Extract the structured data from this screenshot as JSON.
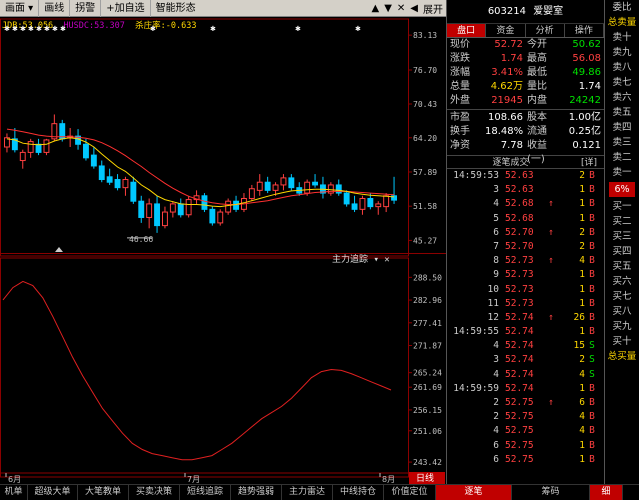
{
  "toolbar": {
    "items": [
      "画面",
      "画线",
      "拐警",
      "+加自选",
      "智能形态"
    ],
    "collapse_label": "展开",
    "up_arrow": "▲",
    "down_arrow": "▼",
    "close": "✕"
  },
  "kline": {
    "indicators": [
      {
        "text": "JDB:53.056",
        "color": "#ffd800"
      },
      {
        "text": "HUSDC:53.307",
        "color": "#c000c0"
      },
      {
        "text": "杀庄率:-0.633",
        "color": "#ffd800"
      }
    ],
    "y_labels": [
      "83.13",
      "76.70",
      "70.43",
      "64.20",
      "57.89",
      "51.58",
      "45.27"
    ],
    "low_label": "46.66",
    "candles": [
      {
        "o": 62.5,
        "h": 65.0,
        "l": 61.5,
        "c": 64.2
      },
      {
        "o": 64.0,
        "h": 66.0,
        "l": 61.5,
        "c": 62.0
      },
      {
        "o": 60.0,
        "h": 62.0,
        "l": 58.5,
        "c": 61.5
      },
      {
        "o": 61.5,
        "h": 64.0,
        "l": 60.5,
        "c": 63.5
      },
      {
        "o": 63.0,
        "h": 64.0,
        "l": 61.0,
        "c": 61.5
      },
      {
        "o": 61.5,
        "h": 64.0,
        "l": 61.0,
        "c": 63.8
      },
      {
        "o": 64.0,
        "h": 68.5,
        "l": 63.5,
        "c": 66.8
      },
      {
        "o": 66.8,
        "h": 67.5,
        "l": 63.5,
        "c": 64.0
      },
      {
        "o": 64.2,
        "h": 66.0,
        "l": 62.5,
        "c": 64.5
      },
      {
        "o": 64.5,
        "h": 65.8,
        "l": 62.0,
        "c": 63.0
      },
      {
        "o": 63.0,
        "h": 64.0,
        "l": 60.0,
        "c": 60.5
      },
      {
        "o": 61.0,
        "h": 62.5,
        "l": 58.5,
        "c": 59.0
      },
      {
        "o": 59.0,
        "h": 60.0,
        "l": 56.0,
        "c": 56.5
      },
      {
        "o": 57.0,
        "h": 58.5,
        "l": 55.5,
        "c": 56.0
      },
      {
        "o": 56.5,
        "h": 57.5,
        "l": 54.5,
        "c": 55.0
      },
      {
        "o": 55.0,
        "h": 57.0,
        "l": 53.5,
        "c": 56.5
      },
      {
        "o": 56.0,
        "h": 57.0,
        "l": 52.0,
        "c": 52.5
      },
      {
        "o": 52.5,
        "h": 53.5,
        "l": 48.5,
        "c": 49.5
      },
      {
        "o": 49.5,
        "h": 53.0,
        "l": 47.5,
        "c": 52.0
      },
      {
        "o": 52.0,
        "h": 53.5,
        "l": 46.66,
        "c": 48.0
      },
      {
        "o": 48.0,
        "h": 51.5,
        "l": 47.5,
        "c": 50.5
      },
      {
        "o": 50.5,
        "h": 52.5,
        "l": 49.5,
        "c": 52.0
      },
      {
        "o": 52.0,
        "h": 53.0,
        "l": 49.5,
        "c": 50.0
      },
      {
        "o": 50.0,
        "h": 53.5,
        "l": 49.5,
        "c": 52.8
      },
      {
        "o": 52.8,
        "h": 54.5,
        "l": 52.0,
        "c": 53.5
      },
      {
        "o": 53.5,
        "h": 54.0,
        "l": 50.5,
        "c": 51.0
      },
      {
        "o": 51.0,
        "h": 51.5,
        "l": 48.0,
        "c": 48.5
      },
      {
        "o": 48.5,
        "h": 51.0,
        "l": 48.0,
        "c": 50.5
      },
      {
        "o": 50.5,
        "h": 53.0,
        "l": 50.0,
        "c": 52.5
      },
      {
        "o": 52.5,
        "h": 53.5,
        "l": 50.5,
        "c": 51.0
      },
      {
        "o": 51.0,
        "h": 54.0,
        "l": 50.5,
        "c": 53.0
      },
      {
        "o": 53.0,
        "h": 55.5,
        "l": 52.5,
        "c": 54.8
      },
      {
        "o": 54.5,
        "h": 57.5,
        "l": 53.5,
        "c": 56.0
      },
      {
        "o": 56.0,
        "h": 57.0,
        "l": 54.0,
        "c": 54.5
      },
      {
        "o": 54.5,
        "h": 56.0,
        "l": 53.5,
        "c": 55.5
      },
      {
        "o": 55.5,
        "h": 57.5,
        "l": 54.5,
        "c": 56.8
      },
      {
        "o": 56.8,
        "h": 57.5,
        "l": 54.5,
        "c": 55.0
      },
      {
        "o": 55.0,
        "h": 56.0,
        "l": 53.5,
        "c": 54.0
      },
      {
        "o": 54.0,
        "h": 56.5,
        "l": 53.5,
        "c": 56.0
      },
      {
        "o": 56.0,
        "h": 57.5,
        "l": 55.0,
        "c": 55.5
      },
      {
        "o": 55.5,
        "h": 57.0,
        "l": 53.0,
        "c": 54.0
      },
      {
        "o": 54.0,
        "h": 56.0,
        "l": 53.5,
        "c": 55.5
      },
      {
        "o": 55.5,
        "h": 56.5,
        "l": 53.5,
        "c": 54.0
      },
      {
        "o": 54.0,
        "h": 54.5,
        "l": 51.5,
        "c": 52.0
      },
      {
        "o": 52.0,
        "h": 53.5,
        "l": 50.5,
        "c": 51.0
      },
      {
        "o": 51.0,
        "h": 53.5,
        "l": 50.0,
        "c": 53.0
      },
      {
        "o": 53.0,
        "h": 54.0,
        "l": 51.0,
        "c": 51.5
      },
      {
        "o": 51.5,
        "h": 52.5,
        "l": 50.0,
        "c": 52.0
      },
      {
        "o": 51.5,
        "h": 54.0,
        "l": 50.5,
        "c": 53.5
      },
      {
        "o": 53.5,
        "h": 57.0,
        "l": 52.0,
        "c": 52.7
      }
    ],
    "ma_fast": [
      64.0,
      63.8,
      63.2,
      63.0,
      62.9,
      63.0,
      63.6,
      64.0,
      64.2,
      64.0,
      63.4,
      62.5,
      61.2,
      60.0,
      58.8,
      58.0,
      56.8,
      55.5,
      54.6,
      53.5,
      52.8,
      52.4,
      52.0,
      51.9,
      51.9,
      51.8,
      51.6,
      51.5,
      51.7,
      51.9,
      52.2,
      52.6,
      53.0,
      53.4,
      53.8,
      54.1,
      54.4,
      54.5,
      54.6,
      54.7,
      54.7,
      54.6,
      54.5,
      54.3,
      54.0,
      53.8,
      53.6,
      53.5,
      53.4,
      53.3
    ],
    "ma_slow": [
      65.8,
      65.6,
      65.3,
      65.0,
      64.7,
      64.5,
      64.4,
      64.4,
      64.4,
      64.3,
      64.1,
      63.8,
      63.3,
      62.6,
      61.8,
      60.9,
      59.9,
      58.9,
      57.8,
      56.8,
      55.8,
      54.9,
      54.1,
      53.4,
      52.9,
      52.5,
      52.2,
      52.0,
      51.9,
      51.9,
      52.0,
      52.2,
      52.4,
      52.6,
      52.9,
      53.2,
      53.5,
      53.7,
      53.9,
      54.1,
      54.2,
      54.3,
      54.3,
      54.3,
      54.2,
      54.1,
      54.0,
      53.9,
      53.8,
      53.7
    ]
  },
  "indicator_panel": {
    "title": "主力追踪",
    "y_labels": [
      "288.50",
      "282.96",
      "277.41",
      "271.87",
      "265.24",
      "261.69",
      "256.15",
      "251.06",
      "243.42"
    ],
    "line": [
      283.0,
      286.0,
      287.5,
      286.5,
      283.5,
      279.0,
      274.0,
      269.0,
      264.5,
      260.5,
      256.5,
      253.5,
      250.5,
      248.0,
      246.5,
      245.5,
      245.0,
      244.5,
      244.0,
      244.0,
      244.5,
      245.0,
      246.5,
      248.0,
      250.0,
      252.0,
      254.0,
      255.5,
      257.0,
      259.0,
      261.5,
      264.0,
      265.5,
      266.0,
      265.8,
      265.0,
      264.0,
      263.0,
      262.0,
      261.0
    ]
  },
  "xaxis": {
    "labels": [
      "6月",
      "7月",
      "8月"
    ],
    "corner_label": "日线"
  },
  "bottom_bar": [
    "机单",
    "超级大单",
    "大笔教单",
    "买卖决策",
    "短线追踪",
    "趋势强弱",
    "主力雷达",
    "中线持仓",
    "价值定位",
    "逐笔",
    "筹码",
    "细"
  ],
  "quote": {
    "code": "603214",
    "name": "爱婴室",
    "tabs": [
      "盘口",
      "资金",
      "分析",
      "操作"
    ],
    "rows1": [
      {
        "l1": "现价",
        "v1": "52.72",
        "c1": "#ff4040",
        "l2": "今开",
        "v2": "50.62",
        "c2": "#00e000"
      },
      {
        "l1": "涨跌",
        "v1": "1.74",
        "c1": "#ff4040",
        "l2": "最高",
        "v2": "56.08",
        "c2": "#ff4040"
      },
      {
        "l1": "涨幅",
        "v1": "3.41%",
        "c1": "#ff4040",
        "l2": "最低",
        "v2": "49.86",
        "c2": "#00e000"
      },
      {
        "l1": "总量",
        "v1": "4.62万",
        "c1": "#ffd800",
        "l2": "量比",
        "v2": "1.74",
        "c2": "#ffffff"
      },
      {
        "l1": "外盘",
        "v1": "21945",
        "c1": "#ff4040",
        "l2": "内盘",
        "v2": "24242",
        "c2": "#00e000"
      }
    ],
    "rows2": [
      {
        "l1": "市盈",
        "v1": "108.66",
        "c1": "#ffffff",
        "l2": "股本",
        "v2": "1.00亿",
        "c2": "#ffffff"
      },
      {
        "l1": "换手",
        "v1": "18.48%",
        "c1": "#ffffff",
        "l2": "流通",
        "v2": "0.25亿",
        "c2": "#ffffff"
      },
      {
        "l1": "净资",
        "v1": "7.78",
        "c1": "#ffffff",
        "l2": "收益(一)",
        "v2": "0.121",
        "c2": "#ffffff"
      }
    ],
    "tick_title": "逐笔成交",
    "tick_extra": "[详]"
  },
  "ticks": [
    {
      "t": "14:59:53",
      "p": "52.63",
      "a": "",
      "v": "2",
      "bs": "B"
    },
    {
      "t": "3",
      "p": "52.63",
      "a": "",
      "v": "1",
      "bs": "B"
    },
    {
      "t": "4",
      "p": "52.68",
      "a": "↑",
      "v": "1",
      "bs": "B"
    },
    {
      "t": "5",
      "p": "52.68",
      "a": "",
      "v": "1",
      "bs": "B"
    },
    {
      "t": "6",
      "p": "52.70",
      "a": "↑",
      "v": "2",
      "bs": "B"
    },
    {
      "t": "7",
      "p": "52.70",
      "a": "",
      "v": "2",
      "bs": "B"
    },
    {
      "t": "8",
      "p": "52.73",
      "a": "↑",
      "v": "4",
      "bs": "B"
    },
    {
      "t": "9",
      "p": "52.73",
      "a": "",
      "v": "1",
      "bs": "B"
    },
    {
      "t": "10",
      "p": "52.73",
      "a": "",
      "v": "1",
      "bs": "B"
    },
    {
      "t": "11",
      "p": "52.73",
      "a": "",
      "v": "1",
      "bs": "B"
    },
    {
      "t": "12",
      "p": "52.74",
      "a": "↑",
      "v": "26",
      "bs": "B"
    },
    {
      "t": "14:59:55",
      "p": "52.74",
      "a": "",
      "v": "1",
      "bs": "B"
    },
    {
      "t": "4",
      "p": "52.74",
      "a": "",
      "v": "15",
      "bs": "S"
    },
    {
      "t": "3",
      "p": "52.74",
      "a": "",
      "v": "2",
      "bs": "S"
    },
    {
      "t": "4",
      "p": "52.74",
      "a": "",
      "v": "4",
      "bs": "S"
    },
    {
      "t": "14:59:59",
      "p": "52.74",
      "a": "",
      "v": "1",
      "bs": "B"
    },
    {
      "t": "2",
      "p": "52.75",
      "a": "↑",
      "v": "6",
      "bs": "B"
    },
    {
      "t": "2",
      "p": "52.75",
      "a": "",
      "v": "4",
      "bs": "B"
    },
    {
      "t": "4",
      "p": "52.75",
      "a": "",
      "v": "4",
      "bs": "B"
    },
    {
      "t": "6",
      "p": "52.75",
      "a": "",
      "v": "1",
      "bs": "B"
    },
    {
      "t": "6",
      "p": "52.75",
      "a": "",
      "v": "1",
      "bs": "B"
    }
  ],
  "side_strip": [
    "委比",
    "总卖量",
    "卖十",
    "卖九",
    "卖八",
    "卖七",
    "卖六",
    "卖五",
    "卖四",
    "卖三",
    "卖二",
    "卖一",
    "6%",
    "买一",
    "买二",
    "买三",
    "买四",
    "买五",
    "买六",
    "买七",
    "买八",
    "买九",
    "买十",
    "总买量"
  ],
  "colors": {
    "up": "#ff4040",
    "down": "#00c8ff",
    "ma_fast": "#ffd800",
    "ma_slow": "#ff3030",
    "indicator_line": "#e02020",
    "grid": "#8b0000"
  }
}
